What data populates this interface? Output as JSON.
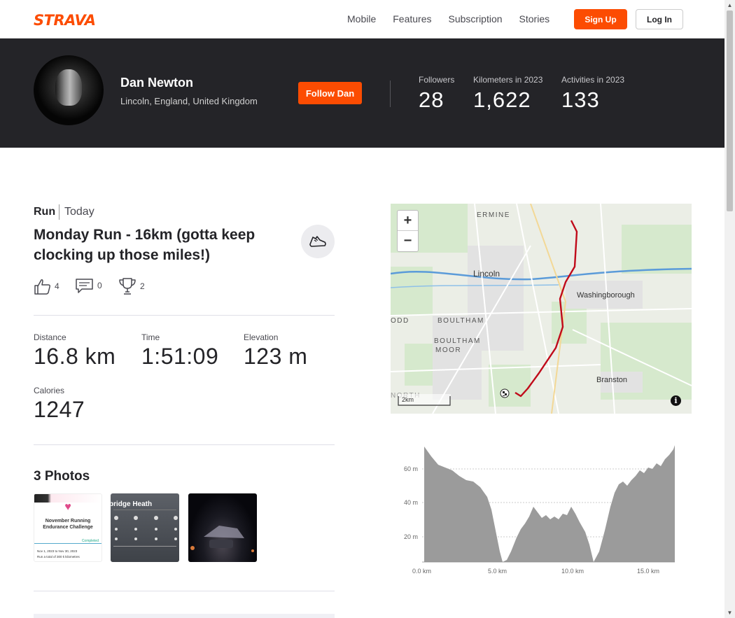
{
  "nav": {
    "logo": "STRAVA",
    "links": [
      "Mobile",
      "Features",
      "Subscription",
      "Stories"
    ],
    "signup": "Sign Up",
    "login": "Log In"
  },
  "athlete": {
    "name": "Dan Newton",
    "location": "Lincoln, England, United Kingdom",
    "follow": "Follow Dan",
    "stats": [
      {
        "label": "Followers",
        "value": "28"
      },
      {
        "label": "Kilometers in 2023",
        "value": "1,622"
      },
      {
        "label": "Activities in 2023",
        "value": "133"
      }
    ]
  },
  "activity": {
    "type": "Run",
    "date": "Today",
    "title": "Monday Run - 16km (gotta keep clocking up those miles!)",
    "kudos": "4",
    "comments": "0",
    "achievements": "2",
    "stats": [
      {
        "label": "Distance",
        "value": "16.8 km"
      },
      {
        "label": "Time",
        "value": "1:51:09"
      },
      {
        "label": "Elevation",
        "value": "123 m"
      },
      {
        "label": "Calories",
        "value": "1247"
      }
    ]
  },
  "photos": {
    "title": "3 Photos",
    "photo1": {
      "heading": "November Running Endurance Challenge",
      "sub": "Run a total of 300 k kilometres",
      "status": "Completed",
      "dates": "Nov 1, 2023 to Nov 30, 2023"
    },
    "photo2": {
      "heading": "bridge Heath"
    }
  },
  "map": {
    "labels": [
      "ERMINE",
      "Lincoln",
      "Washingborough",
      "BOULTHAM",
      "BOULTHAM",
      "MOOR",
      "Branston",
      "ODD",
      "NORTH"
    ],
    "scale": "2km",
    "zoom_in": "+",
    "zoom_out": "−",
    "info": "i"
  },
  "elevation": {
    "y_ticks": [
      "60 m",
      "40 m",
      "20 m"
    ],
    "x_ticks": [
      "0.0 km",
      "5.0 km",
      "10.0 km",
      "15.0 km"
    ]
  },
  "colors": {
    "brand": "#fc4c02",
    "header_bg": "#242428",
    "route": "#c00a1a",
    "elevation_fill": "#9b9b9b"
  }
}
